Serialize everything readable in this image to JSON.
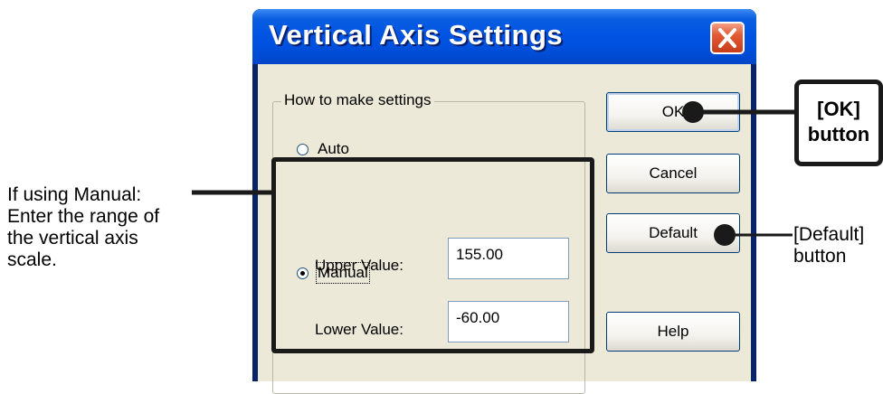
{
  "window": {
    "title": "Vertical Axis Settings",
    "close_glyph": "✕",
    "group_title": "How to make settings",
    "radio_auto": "Auto",
    "radio_manual": "Manual",
    "selected_mode": "Manual",
    "upper_label": "Upper Value:",
    "upper_value": "155.00",
    "lower_label": "Lower Value:",
    "lower_value": "-60.00",
    "buttons": {
      "ok": "OK",
      "cancel": "Cancel",
      "default": "Default",
      "help": "Help"
    }
  },
  "annotations": {
    "manual_note": [
      "If using Manual:",
      "Enter the range of",
      "the vertical axis",
      "scale."
    ],
    "ok_callout": [
      "[OK]",
      "button"
    ],
    "default_callout": [
      "[Default]",
      "button"
    ]
  },
  "colors": {
    "titlebar": "#0054e3",
    "close_button": "#e25a35",
    "dialog_face": "#ece9d8",
    "annotation_line": "#1a1a1a"
  }
}
